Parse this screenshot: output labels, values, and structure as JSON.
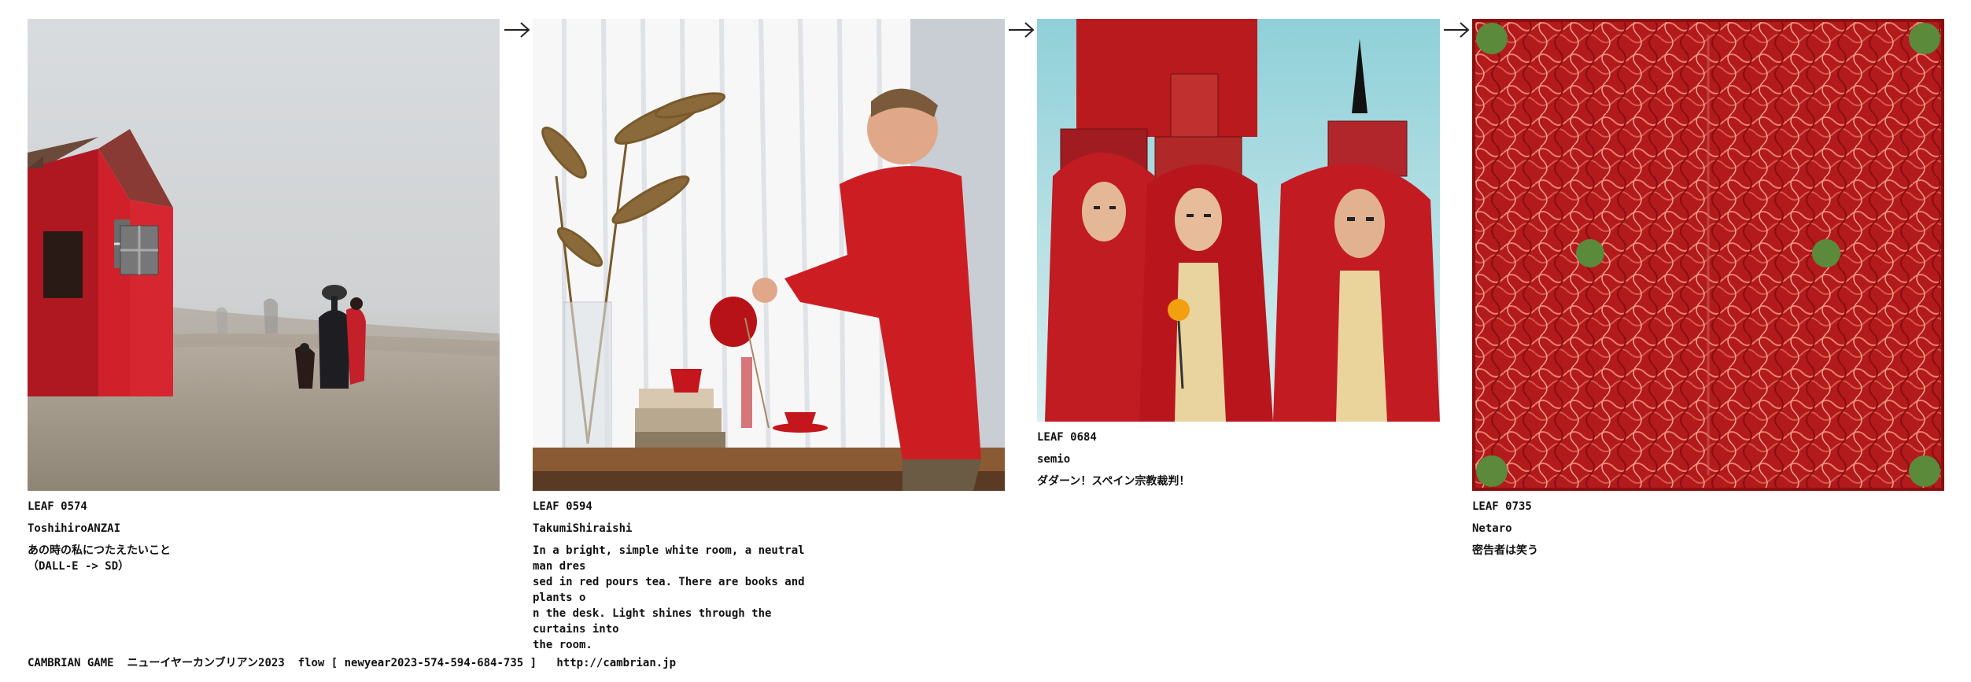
{
  "cards": [
    {
      "leaf": "LEAF 0574",
      "author": "ToshihiroANZAI",
      "desc": "あの時の私につたえたいこと\n（DALL-E -> SD）",
      "image": "misty-desert-red-house-family"
    },
    {
      "leaf": "LEAF 0594",
      "author": "TakumiShiraishi",
      "desc": "In a bright, simple white room, a neutral man dres\nsed in red pours tea. There are books and plants o\nn the desk. Light shines through the curtains into\n the room.",
      "image": "man-in-red-pouring-tea"
    },
    {
      "leaf": "LEAF 0684",
      "author": "semio",
      "desc": "ダダーン！スペイン宗教裁判！",
      "image": "red-robed-cardinals"
    },
    {
      "leaf": "LEAF 0735",
      "author": "Netaro",
      "desc": "密告者は笑う",
      "image": "red-noodle-texture"
    }
  ],
  "footer": {
    "game": "CAMBRIAN GAME",
    "event": "ニューイヤーカンブリアン2023",
    "flow": "flow [ newyear2023-574-594-684-735 ]",
    "url": "http://cambrian.jp"
  },
  "colors": {
    "accent_red": "#c8161d",
    "text": "#111111"
  }
}
